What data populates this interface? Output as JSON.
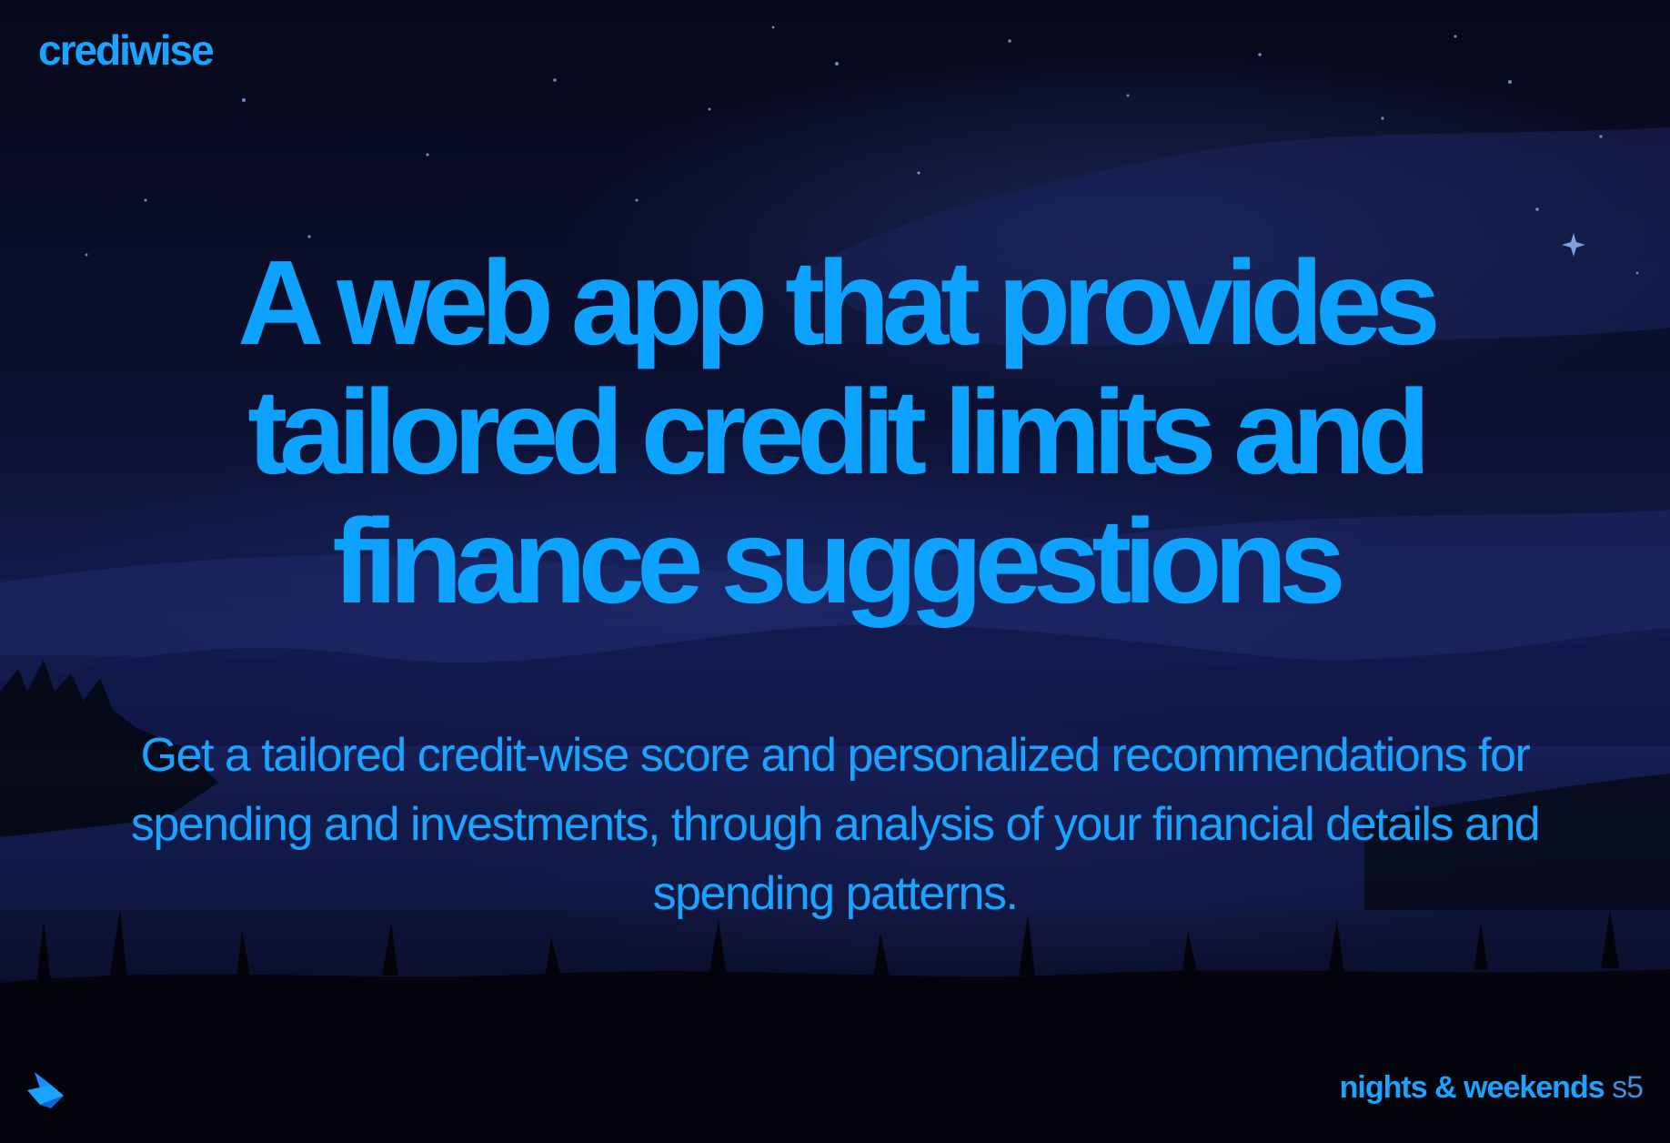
{
  "brand": {
    "logo_text": "crediwise"
  },
  "hero": {
    "headline": "A web app that provides tailored credit limits and finance suggestions",
    "subtext": "Get a tailored credit-wise score and personalized recommendations for spending and investments, through analysis of your financial details and spending patterns."
  },
  "footer": {
    "brand_main": "nights & weekends",
    "brand_season": "s5",
    "icon": "buildspace-logo-icon"
  },
  "colors": {
    "accent": "#0ea2ff",
    "background": "#0b1030"
  }
}
